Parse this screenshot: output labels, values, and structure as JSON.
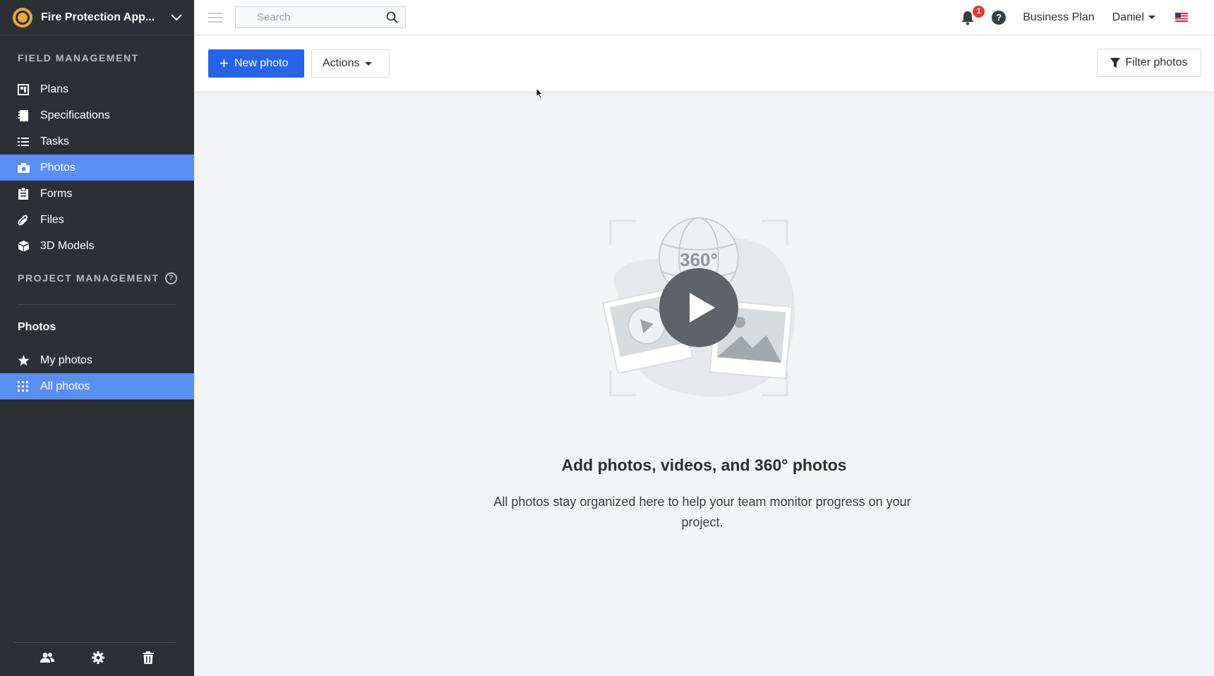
{
  "sidebar": {
    "project_name": "Fire Protection App...",
    "field_management_title": "FIELD MANAGEMENT",
    "items": [
      {
        "label": "Plans",
        "icon": "plans-icon"
      },
      {
        "label": "Specifications",
        "icon": "specifications-icon"
      },
      {
        "label": "Tasks",
        "icon": "tasks-icon"
      },
      {
        "label": "Photos",
        "icon": "camera-icon",
        "active": true
      },
      {
        "label": "Forms",
        "icon": "forms-icon"
      },
      {
        "label": "Files",
        "icon": "paperclip-icon"
      },
      {
        "label": "3D Models",
        "icon": "cube-icon"
      }
    ],
    "project_management_title": "PROJECT MANAGEMENT",
    "help_glyph": "?",
    "photos_title": "Photos",
    "photo_items": [
      {
        "label": "My photos",
        "icon": "star-icon"
      },
      {
        "label": "All photos",
        "icon": "grid-icon",
        "active": true
      }
    ],
    "footer_icons": [
      "users-icon",
      "gear-icon",
      "trash-icon"
    ]
  },
  "topbar": {
    "search_placeholder": "Search",
    "notification_count": "1",
    "help_glyph": "?",
    "plan": "Business Plan",
    "user": "Daniel",
    "flag": "us-flag-icon"
  },
  "toolbar": {
    "new_photo_label": "New photo",
    "actions_label": "Actions",
    "filter_label": "Filter photos"
  },
  "empty_state": {
    "badge_360": "360°",
    "title": "Add photos, videos, and 360° photos",
    "description": "All photos stay organized here to help your team monitor progress on your project."
  },
  "colors": {
    "sidebar_bg": "#2c3035",
    "active_item": "#5b8ef5",
    "primary_button": "#2563eb",
    "notification_badge": "#e53935"
  }
}
